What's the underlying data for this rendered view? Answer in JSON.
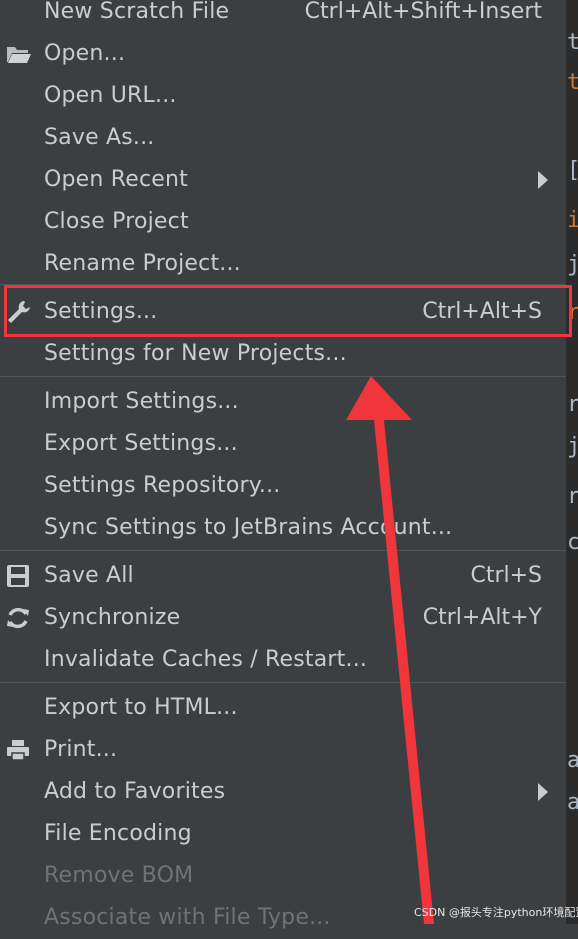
{
  "menu": {
    "items": [
      {
        "label": "New Scratch File",
        "shortcut": "Ctrl+Alt+Shift+Insert"
      },
      {
        "label": "Open...",
        "icon": "folder-icon"
      },
      {
        "label": "Open URL..."
      },
      {
        "label": "Save As..."
      },
      {
        "label": "Open Recent",
        "submenu": true
      },
      {
        "label": "Close Project"
      },
      {
        "label": "Rename Project..."
      },
      {
        "label": "Settings...",
        "shortcut": "Ctrl+Alt+S",
        "icon": "wrench-icon"
      },
      {
        "label": "Settings for New Projects..."
      },
      {
        "label": "Import Settings..."
      },
      {
        "label": "Export Settings..."
      },
      {
        "label": "Settings Repository..."
      },
      {
        "label": "Sync Settings to JetBrains Account..."
      },
      {
        "label": "Save All",
        "shortcut": "Ctrl+S",
        "icon": "save-icon"
      },
      {
        "label": "Synchronize",
        "shortcut": "Ctrl+Alt+Y",
        "icon": "sync-icon"
      },
      {
        "label": "Invalidate Caches / Restart..."
      },
      {
        "label": "Export to HTML..."
      },
      {
        "label": "Print...",
        "icon": "print-icon"
      },
      {
        "label": "Add to Favorites",
        "submenu": true
      },
      {
        "label": "File Encoding"
      },
      {
        "label": "Remove BOM",
        "disabled": true
      },
      {
        "label": "Associate with File Type...",
        "disabled": true
      }
    ]
  },
  "editor_chars": [
    {
      "char": "t",
      "color": "#a9b7c6"
    },
    {
      "char": "t",
      "color": "#cc7832"
    },
    {
      "char": "[",
      "color": "#a9b7c6"
    },
    {
      "char": "i",
      "color": "#cc7832"
    },
    {
      "char": "j",
      "color": "#a9b7c6"
    },
    {
      "char": "r",
      "color": "#cc7832"
    },
    {
      "char": "r",
      "color": "#a9b7c6"
    },
    {
      "char": "j",
      "color": "#a9b7c6"
    },
    {
      "char": "r",
      "color": "#a9b7c6"
    },
    {
      "char": "c",
      "color": "#a9b7c6"
    },
    {
      "char": "a",
      "color": "#a9b7c6"
    },
    {
      "char": "a",
      "color": "#a9b7c6"
    }
  ],
  "colors": {
    "menu_bg": "#3c3f41",
    "text": "#c9cdd1",
    "disabled_text": "#6f7376",
    "highlight_border": "#f0353b",
    "annotation_arrow": "#f0353b"
  },
  "watermark": "CSDN @报头专注python环境配置"
}
